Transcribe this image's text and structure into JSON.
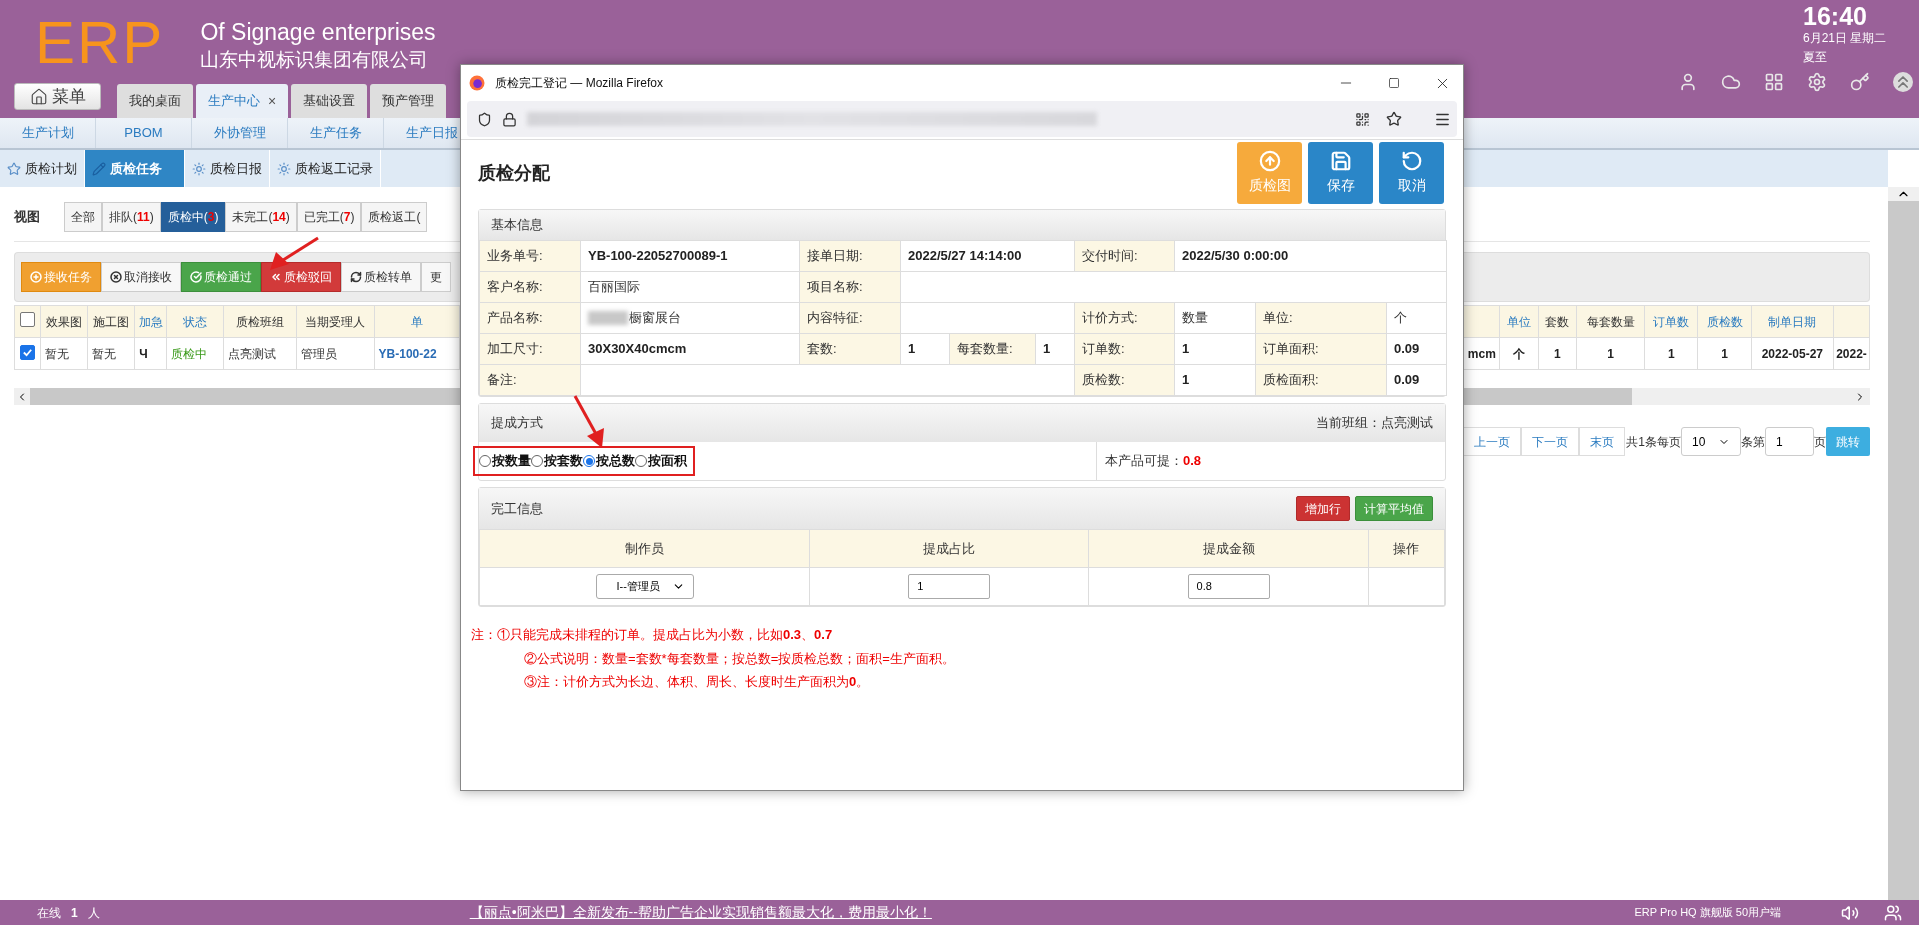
{
  "header": {
    "logo": "ERP",
    "slogan": "Of Signage enterprises",
    "company": "山东中视标识集团有限公司",
    "time": "16:40",
    "date": "6月21日 星期二",
    "solar_term": "夏至"
  },
  "menu_button": "菜单",
  "main_tabs": [
    {
      "label": "我的桌面",
      "selected": false
    },
    {
      "label": "生产中心",
      "selected": true,
      "close": "×"
    },
    {
      "label": "基础设置",
      "selected": false
    },
    {
      "label": "预产管理",
      "selected": false
    }
  ],
  "sub_menu": [
    "生产计划",
    "PBOM",
    "外协管理",
    "生产任务",
    "生产日报"
  ],
  "module_tabs": [
    {
      "label": "质检计划",
      "kind": "star",
      "selected": false
    },
    {
      "label": "质检任务",
      "kind": "edit",
      "selected": true
    },
    {
      "label": "质检日报",
      "kind": "sun",
      "selected": false
    },
    {
      "label": "质检返工记录",
      "kind": "sun",
      "selected": false
    }
  ],
  "view": {
    "label": "视图",
    "tabs": [
      {
        "label": "全部",
        "selected": false
      },
      {
        "label": "排队(",
        "count": "11",
        "tail": ")",
        "selected": false
      },
      {
        "label": "质检中(",
        "count": "3",
        "tail": ")",
        "selected": true
      },
      {
        "label": "未完工(",
        "count": "14",
        "tail": ")",
        "selected": false
      },
      {
        "label": "已完工(",
        "count": "7",
        "tail": ")",
        "selected": false
      },
      {
        "label": "质检返工(",
        "selected": false
      }
    ]
  },
  "toolbar": [
    {
      "label": "接收任务",
      "kind": "accept"
    },
    {
      "label": "取消接收",
      "kind": "cancel"
    },
    {
      "label": "质检通过",
      "kind": "pass"
    },
    {
      "label": "质检驳回",
      "kind": "reject"
    },
    {
      "label": "质检转单",
      "kind": "transfer"
    },
    {
      "label": "更",
      "kind": "more"
    }
  ],
  "table": {
    "header_checked": false,
    "columns": [
      {
        "label": "效果图",
        "link": false
      },
      {
        "label": "施工图",
        "link": false
      },
      {
        "label": "加急",
        "link": true
      },
      {
        "label": "状态",
        "link": true
      },
      {
        "label": "质检班组",
        "link": false
      },
      {
        "label": "当期受理人",
        "link": false
      },
      {
        "label": "单",
        "link": true
      }
    ],
    "rows": [
      {
        "checked": true,
        "cells": [
          {
            "text": "暂无",
            "kind": "plain"
          },
          {
            "text": "暂无",
            "kind": "plain"
          },
          {
            "text": "Ч",
            "kind": "strong"
          },
          {
            "text": "质检中",
            "kind": "status"
          },
          {
            "text": "点亮测试",
            "kind": "plain"
          },
          {
            "text": "管理员",
            "kind": "plain"
          },
          {
            "text": "YB-100-22",
            "kind": "link"
          }
        ]
      }
    ]
  },
  "table_right": {
    "columns": [
      {},
      {
        "label": "单位",
        "link": true
      },
      {
        "label": "套数",
        "link": false
      },
      {
        "label": "每套数量",
        "link": false
      },
      {
        "label": "订单数",
        "link": true
      },
      {
        "label": "质检数",
        "link": true
      },
      {
        "label": "制单日期",
        "link": true
      },
      {}
    ],
    "rows": [
      [
        "mcm",
        "个",
        "1",
        "1",
        "1",
        "1",
        "2022-05-27",
        "2022-"
      ]
    ]
  },
  "pagination": {
    "prev": "上一页",
    "next": "下一页",
    "last": "末页",
    "total": "共1条每页",
    "page_size": "10",
    "page_label": "条第",
    "page": "1",
    "page_suffix": "页",
    "go": "跳转"
  },
  "status_bar": {
    "online": "在线",
    "online_count": "1",
    "online_unit": "人",
    "announcement": "【丽点•阿米巴】全新发布--帮助广告企业实现销售额最大化，费用最小化！",
    "edition": "ERP Pro HQ 旗舰版 50用户端"
  },
  "popup": {
    "window_title": "质检完工登记 — Mozilla Firefox",
    "title": "质检分配",
    "actions": [
      {
        "label": "质检图",
        "kind": "upload"
      },
      {
        "label": "保存",
        "kind": "save"
      },
      {
        "label": "取消",
        "kind": "undo"
      }
    ],
    "basic_info": {
      "title": "基本信息",
      "rows": [
        [
          {
            "text": "业务单号:",
            "kind": "label"
          },
          {
            "text": "YB-100-22052700089-1",
            "kind": "strong"
          },
          {
            "text": "接单日期:",
            "kind": "label"
          },
          {
            "text": "2022/5/27 14:14:00",
            "kind": "strong",
            "colspan": 3
          },
          {
            "text": "交付时间:",
            "kind": "label"
          },
          {
            "text": "2022/5/30 0:00:00",
            "kind": "strong",
            "colspan": 3
          }
        ],
        [
          {
            "text": "客户名称:",
            "kind": "label"
          },
          {
            "text": "百丽国际",
            "kind": "value"
          },
          {
            "text": "项目名称:",
            "kind": "label"
          },
          {
            "kind": "empty",
            "colspan": 7
          }
        ],
        [
          {
            "text": "产品名称:",
            "kind": "label"
          },
          {
            "text": "橱窗展台",
            "kind": "redacted"
          },
          {
            "text": "内容特征:",
            "kind": "label"
          },
          {
            "kind": "empty",
            "colspan": 3
          },
          {
            "text": "计价方式:",
            "kind": "label"
          },
          {
            "text": "数量",
            "kind": "value"
          },
          {
            "text": "单位:",
            "kind": "label"
          },
          {
            "text": "个",
            "kind": "value"
          }
        ],
        [
          {
            "text": "加工尺寸:",
            "kind": "label"
          },
          {
            "text": "30X30X40cmcm",
            "kind": "strong"
          },
          {
            "text": "套数:",
            "kind": "label"
          },
          {
            "text": "1",
            "kind": "strong"
          },
          {
            "text": "每套数量:",
            "kind": "label"
          },
          {
            "text": "1",
            "kind": "strong"
          },
          {
            "text": "订单数:",
            "kind": "label"
          },
          {
            "text": "1",
            "kind": "strong"
          },
          {
            "text": "订单面积:",
            "kind": "label"
          },
          {
            "text": "0.09",
            "kind": "strong"
          }
        ],
        [
          {
            "text": "备注:",
            "kind": "label"
          },
          {
            "kind": "empty",
            "colspan": 5
          },
          {
            "text": "质检数:",
            "kind": "label"
          },
          {
            "text": "1",
            "kind": "strong"
          },
          {
            "text": "质检面积:",
            "kind": "label"
          },
          {
            "text": "0.09",
            "kind": "strong"
          }
        ]
      ]
    },
    "commission": {
      "title": "提成方式",
      "group_label": "当前班组：点亮测试",
      "options": [
        {
          "label": "按数量",
          "selected": false
        },
        {
          "label": "按套数",
          "selected": false
        },
        {
          "label": "按总数",
          "selected": true
        },
        {
          "label": "按面积",
          "selected": false
        }
      ],
      "payable_label": "本产品可提：",
      "payable": "0.8"
    },
    "completion": {
      "title": "完工信息",
      "buttons": [
        {
          "label": "增加行",
          "kind": "danger"
        },
        {
          "label": "计算平均值",
          "kind": "success"
        }
      ],
      "columns": [
        "制作员",
        "提成占比",
        "提成金额",
        "操作"
      ],
      "rows": [
        {
          "maker": "I--管理员",
          "ratio": "1",
          "amount": "0.8"
        }
      ]
    },
    "notes": [
      "注：①只能完成未排程的订单。提成占比为小数，比如**0.3**、**0.7**",
      "②公式说明：数量=套数*每套数量；按总数=按质检总数；面积=生产面积。",
      "③注：计价方式为长边、体积、周长、长度时生产面积为**0**。"
    ]
  }
}
